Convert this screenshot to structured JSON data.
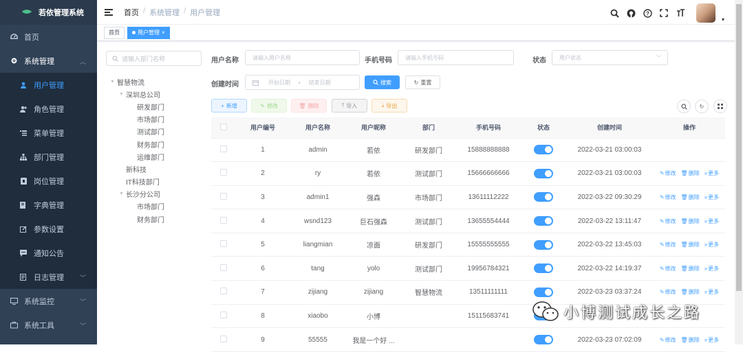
{
  "app": {
    "title": "若依管理系统"
  },
  "sidebar": {
    "items": [
      {
        "label": "首页",
        "icon": "dashboard-icon"
      },
      {
        "label": "系统管理",
        "icon": "gear-icon",
        "expanded": true
      },
      {
        "label": "系统监控",
        "icon": "monitor-icon"
      },
      {
        "label": "系统工具",
        "icon": "tool-icon"
      }
    ],
    "system_children": [
      {
        "label": "用户管理",
        "icon": "user-icon",
        "active": true
      },
      {
        "label": "角色管理",
        "icon": "peoples-icon"
      },
      {
        "label": "菜单管理",
        "icon": "tree-table-icon"
      },
      {
        "label": "部门管理",
        "icon": "tree-icon"
      },
      {
        "label": "岗位管理",
        "icon": "post-icon"
      },
      {
        "label": "字典管理",
        "icon": "dict-icon"
      },
      {
        "label": "参数设置",
        "icon": "edit-icon"
      },
      {
        "label": "通知公告",
        "icon": "message-icon"
      },
      {
        "label": "日志管理",
        "icon": "log-icon"
      }
    ]
  },
  "header": {
    "breadcrumb": [
      "首页",
      "系统管理",
      "用户管理"
    ]
  },
  "tags": {
    "home": "首页",
    "active": "用户管理",
    "close": "×"
  },
  "dept_tree": {
    "search_placeholder": "请输入部门名称",
    "nodes": [
      {
        "label": "智慧物流",
        "level": 0,
        "arrow": true
      },
      {
        "label": "深圳总公司",
        "level": 1,
        "arrow": true
      },
      {
        "label": "研发部门",
        "level": 2
      },
      {
        "label": "市场部门",
        "level": 2
      },
      {
        "label": "测试部门",
        "level": 2
      },
      {
        "label": "财务部门",
        "level": 2
      },
      {
        "label": "运维部门",
        "level": 2
      },
      {
        "label": "新科技",
        "level": 1
      },
      {
        "label": "IT科技部门",
        "level": 1
      },
      {
        "label": "长沙分公司",
        "level": 1,
        "arrow": true
      },
      {
        "label": "市场部门",
        "level": 2
      },
      {
        "label": "财务部门",
        "level": 2
      }
    ]
  },
  "query": {
    "username_label": "用户名称",
    "username_placeholder": "请输入用户名称",
    "phone_label": "手机号码",
    "phone_placeholder": "请输入手机号码",
    "status_label": "状态",
    "status_placeholder": "用户状态",
    "created_label": "创建时间",
    "start_placeholder": "开始日期",
    "range_sep": "-",
    "end_placeholder": "结束日期",
    "search_button": "搜索",
    "reset_button": "重置"
  },
  "toolbar": {
    "add": "新增",
    "edit": "修改",
    "delete": "删除",
    "import": "导入",
    "export": "导出"
  },
  "table": {
    "columns": [
      "用户编号",
      "用户名称",
      "用户昵称",
      "部门",
      "手机号码",
      "状态",
      "创建时间",
      "操作"
    ],
    "rows": [
      {
        "id": "1",
        "username": "admin",
        "nickname": "若依",
        "dept": "研发部门",
        "phone": "15888888888",
        "enabled": true,
        "created": "2022-03-21 03:00:03",
        "has_ops": false
      },
      {
        "id": "2",
        "username": "ry",
        "nickname": "若依",
        "dept": "测试部门",
        "phone": "15666666666",
        "enabled": true,
        "created": "2022-03-21 03:00:03",
        "has_ops": true
      },
      {
        "id": "3",
        "username": "admin1",
        "nickname": "强森",
        "dept": "市场部门",
        "phone": "13611112222",
        "enabled": true,
        "created": "2022-03-22 09:30:29",
        "has_ops": true
      },
      {
        "id": "4",
        "username": "wsnd123",
        "nickname": "巨石强森",
        "dept": "测试部门",
        "phone": "13655554444",
        "enabled": true,
        "created": "2022-03-22 13:11:47",
        "has_ops": true
      },
      {
        "id": "5",
        "username": "liangmian",
        "nickname": "凉面",
        "dept": "研发部门",
        "phone": "15555555555",
        "enabled": true,
        "created": "2022-03-22 13:45:03",
        "has_ops": true
      },
      {
        "id": "6",
        "username": "tang",
        "nickname": "yolo",
        "dept": "测试部门",
        "phone": "19956784321",
        "enabled": true,
        "created": "2022-03-22 14:19:37",
        "has_ops": true
      },
      {
        "id": "7",
        "username": "zijiang",
        "nickname": "zijiang",
        "dept": "智慧物流",
        "phone": "13511111111",
        "enabled": true,
        "created": "2022-03-23 03:37:24",
        "has_ops": true
      },
      {
        "id": "8",
        "username": "xiaobo",
        "nickname": "小博",
        "dept": "",
        "phone": "15115683741",
        "enabled": true,
        "created": "",
        "has_ops": false
      },
      {
        "id": "9",
        "username": "55555",
        "nickname": "我是一个好 ...",
        "dept": "",
        "phone": "",
        "enabled": true,
        "created": "2022-03-23 07:02:09",
        "has_ops": true
      }
    ],
    "op_edit": "修改",
    "op_delete": "删除",
    "op_more": "更多"
  },
  "watermark": {
    "text": "小博测试成长之路"
  },
  "colors": {
    "primary": "#409eff",
    "sidebar_bg": "#304156",
    "sidebar_sub_bg": "#1f2d3d"
  }
}
